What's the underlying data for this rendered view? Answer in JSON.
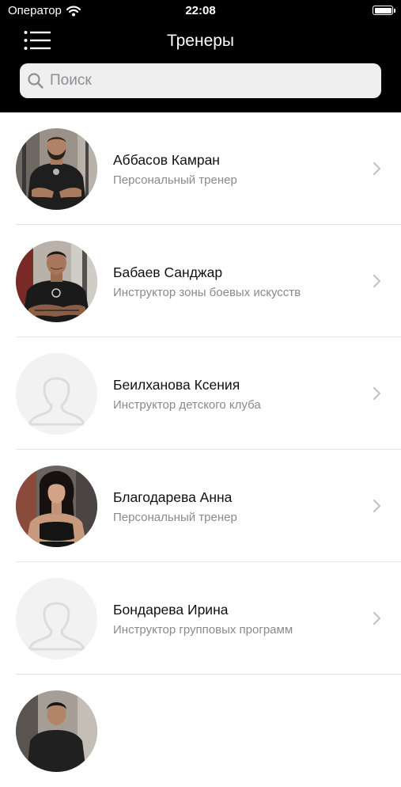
{
  "status_bar": {
    "carrier": "Оператор",
    "time": "22:08"
  },
  "header": {
    "title": "Тренеры",
    "menu_icon": "menu-icon"
  },
  "search": {
    "placeholder": "Поиск",
    "value": ""
  },
  "trainers": [
    {
      "name": "Аббасов Камран",
      "role": "Персональный тренер",
      "avatar": "photo-man-black-shirt"
    },
    {
      "name": "Бабаев Санджар",
      "role": "Инструктор зоны боевых искусств",
      "avatar": "photo-man-arms-crossed"
    },
    {
      "name": "Беилханова Ксения",
      "role": "Инструктор детского клуба",
      "avatar": "placeholder-person-icon"
    },
    {
      "name": "Благодарева Анна",
      "role": "Персональный тренер",
      "avatar": "photo-woman-sports-top"
    },
    {
      "name": "Бондарева Ирина",
      "role": "Инструктор групповых программ",
      "avatar": "placeholder-person-icon"
    },
    {
      "name": "",
      "role": "",
      "avatar": "photo-man-partial"
    }
  ],
  "colors": {
    "header_bg": "#000000",
    "search_bg": "#efeff0",
    "name_text": "#111111",
    "role_text": "#8a8a8a",
    "chevron": "#c4c4c7",
    "divider": "#e6e6e6"
  }
}
